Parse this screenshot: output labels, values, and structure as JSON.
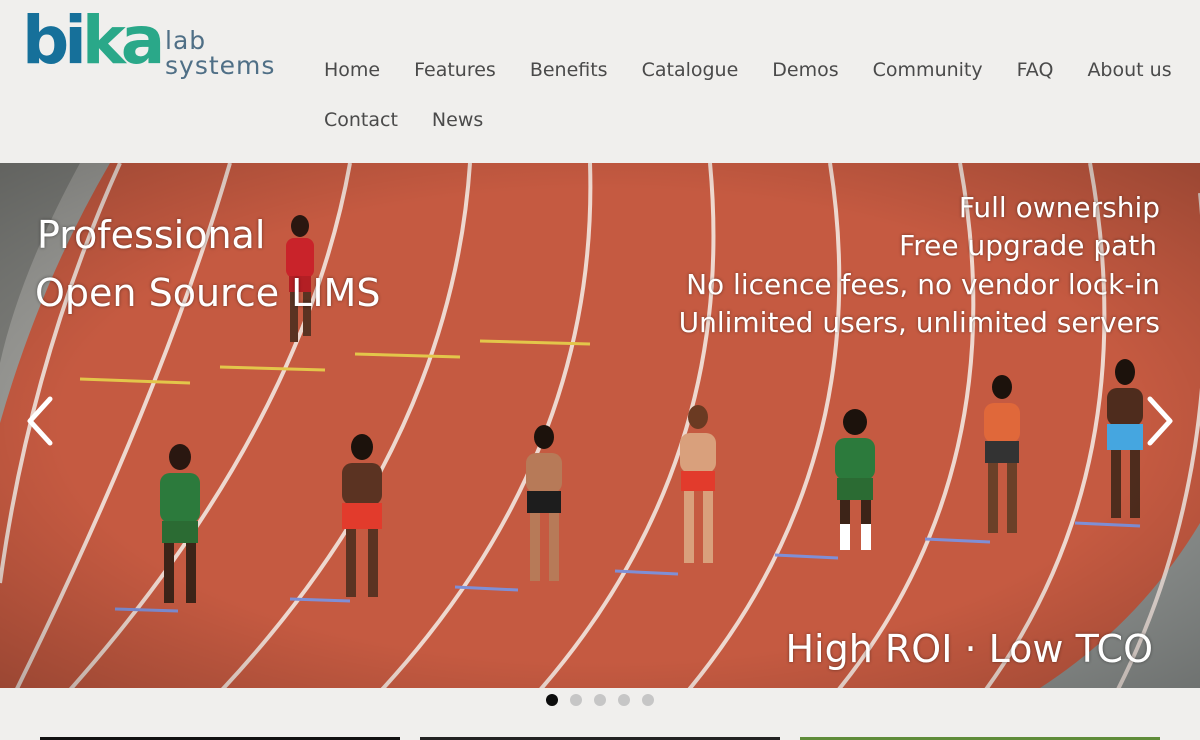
{
  "logo": {
    "text_bika_main": "bi",
    "text_bika_accent": "ka",
    "text_lab": "lab",
    "text_systems": "systems"
  },
  "nav": {
    "row1": [
      "Home",
      "Features",
      "Benefits",
      "Catalogue",
      "Demos",
      "Community",
      "FAQ",
      "About us"
    ],
    "row2": [
      "Contact",
      "News"
    ]
  },
  "slider": {
    "left_line1": "Professional",
    "left_line2": "Open Source LIMS",
    "right_lines": [
      "Full ownership",
      "Free upgrade path",
      "No licence fees, no vendor lock-in",
      "Unlimited users, unlimited servers"
    ],
    "bottom": "High ROI · Low TCO",
    "slide_count": 5,
    "active_slide": 1
  },
  "colors": {
    "track": "#c0513a",
    "brand_blue": "#16709a",
    "brand_green": "#2aa889",
    "nav_text": "#4a4a4a"
  },
  "icons": {
    "prev": "chevron-left-icon",
    "next": "chevron-right-icon"
  }
}
